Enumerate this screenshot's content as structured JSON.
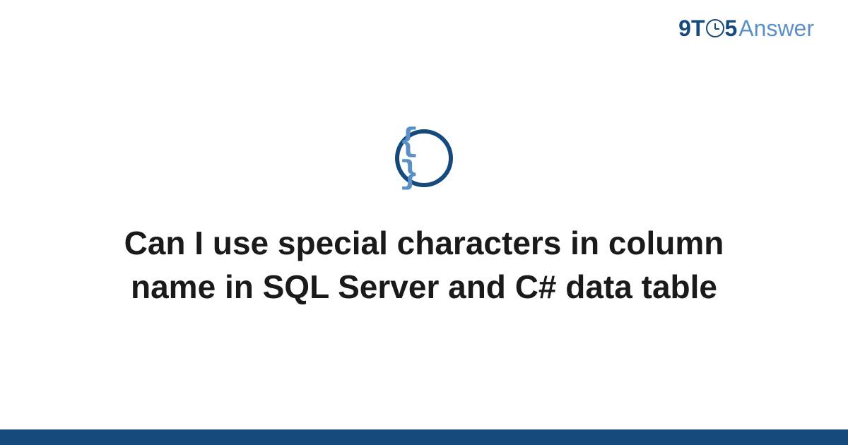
{
  "brand": {
    "prefix": "9T",
    "suffix": "5",
    "word": "Answer"
  },
  "icon": {
    "glyph": "{ }"
  },
  "title": "Can I use special characters in column name in SQL Server and C# data table",
  "colors": {
    "primary": "#174a7c",
    "accent": "#5a8fc7"
  }
}
